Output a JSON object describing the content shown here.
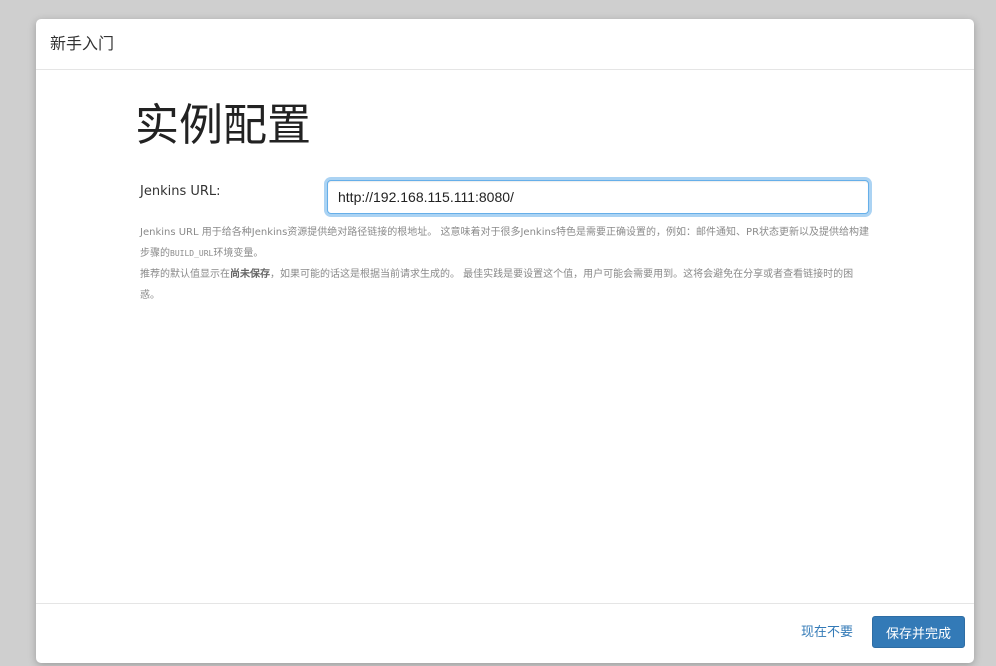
{
  "modal": {
    "title": "新手入门"
  },
  "main": {
    "page_title": "实例配置",
    "url_label": "Jenkins URL:",
    "url_value": "http://192.168.115.111:8080/",
    "help": {
      "p1_text": "Jenkins URL 用于给各种Jenkins资源提供绝对路径链接的根地址。 这意味着对于很多Jenkins特色是需要正确设置的，例如：邮件通知、PR状态更新以及提供给构建步骤的",
      "p1_code": "BUILD_URL",
      "p1_suffix": "环境变量。",
      "p2_prefix": "推荐的默认值显示在",
      "p2_strong": "尚未保存",
      "p2_suffix": "，如果可能的话这是根据当前请求生成的。 最佳实践是要设置这个值，用户可能会需要用到。这将会避免在分享或者查看链接时的困惑。"
    }
  },
  "footer": {
    "skip_label": "现在不要",
    "save_label": "保存并完成"
  },
  "colors": {
    "accent": "#337ab7",
    "focus_ring": "#66afe9",
    "backdrop": "#cfcfcf"
  }
}
